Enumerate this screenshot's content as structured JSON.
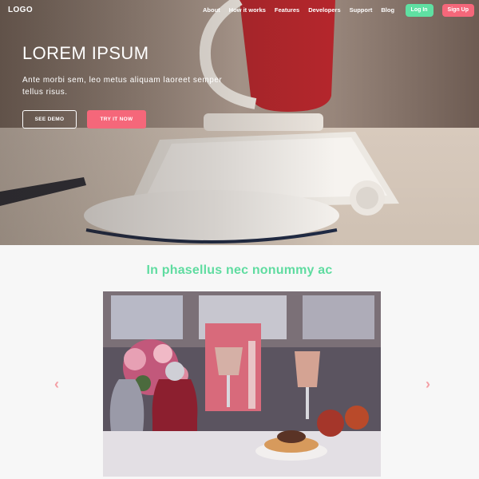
{
  "nav": {
    "logo": "LOGO",
    "links": [
      "About",
      "How it works",
      "Features",
      "Developers",
      "Support",
      "Blog"
    ],
    "login_label": "Log In",
    "signup_label": "Sign Up"
  },
  "hero": {
    "title": "LOREM IPSUM",
    "subtitle": "Ante morbi sem, leo metus aliquam laoreet semper tellus risus.",
    "demo_label": "SEE DEMO",
    "try_label": "TRY IT NOW"
  },
  "section": {
    "title": "In phasellus nec nonummy ac"
  },
  "carousel": {
    "prev_icon": "chevron-left-icon",
    "next_icon": "chevron-right-icon"
  },
  "colors": {
    "accent_green": "#5fe0a2",
    "accent_pink": "#f5677a",
    "section_title": "#5fdca0",
    "arrow": "#f4a0a6"
  }
}
